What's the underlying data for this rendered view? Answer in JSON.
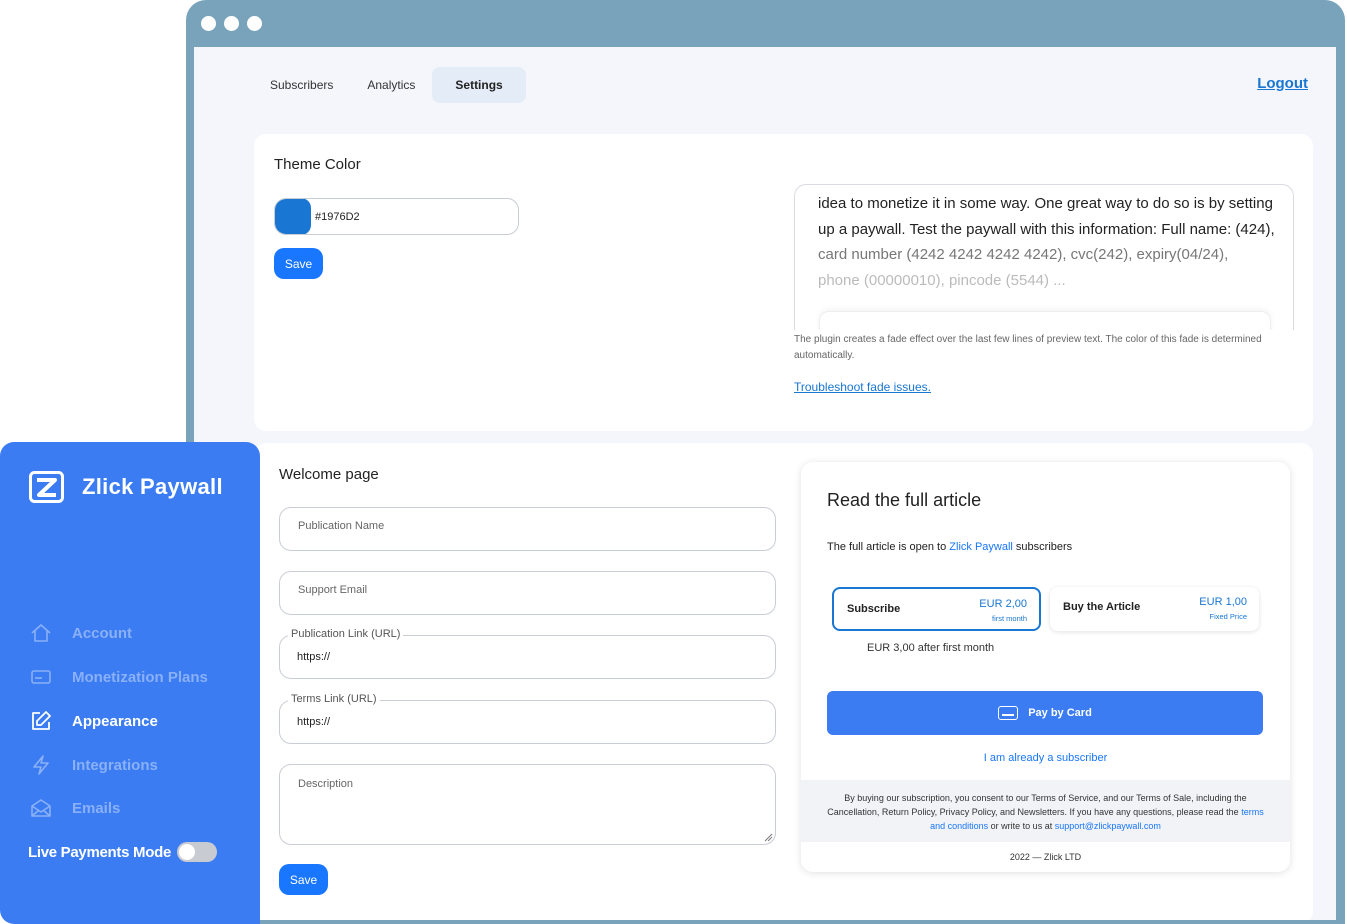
{
  "nav": {
    "tabs": [
      {
        "label": "Subscribers"
      },
      {
        "label": "Analytics"
      },
      {
        "label": "Settings"
      }
    ],
    "logout_label": "Logout"
  },
  "theme": {
    "title": "Theme Color",
    "color_value": "#1976D2",
    "save_label": "Save",
    "preview_lines": [
      "idea to monetize it in some way. One great way to do so is by setting",
      "up a paywall. Test the paywall with this information: Full name: (424),",
      "card number (4242 4242 4242 4242), cvc(242), expiry(04/24),",
      "phone (00000010), pincode (5544) ..."
    ],
    "fade_note": "The plugin creates a fade effect over the last few lines of preview text. The color of this fade is determined automatically.",
    "fade_link": "Troubleshoot fade issues."
  },
  "welcome": {
    "title": "Welcome page",
    "publication_name_placeholder": "Publication Name",
    "support_email_placeholder": "Support Email",
    "publication_link_label": "Publication Link (URL)",
    "publication_link_value": "https://",
    "terms_link_label": "Terms Link (URL)",
    "terms_link_value": "https://",
    "description_placeholder": "Description",
    "save_label": "Save"
  },
  "paywall": {
    "title": "Read the full article",
    "subtitle_prefix": "The full article is open to ",
    "subtitle_brand": "Zlick Paywall",
    "subtitle_suffix": " subscribers",
    "options": [
      {
        "name": "Subscribe",
        "price": "EUR 2,00",
        "note": "first month"
      },
      {
        "name": "Buy the Article",
        "price": "EUR 1,00",
        "note": "Fixed Price"
      }
    ],
    "after_text": "EUR 3,00 after first month",
    "pay_label": "Pay by Card",
    "already_label": "I am already a subscriber",
    "legal_text": "By buying our subscription, you consent to our Terms of Service, and our Terms of Sale, including the Cancellation, Return Policy, Privacy Policy, and Newsletters. If you have any questions, please read the ",
    "legal_link": "terms and conditions",
    "legal_mid": " or write to us at ",
    "legal_email": "support@zlickpaywall.com",
    "copyright": "2022 — Zlick LTD"
  },
  "sidebar": {
    "brand": "Zlick Paywall",
    "items": [
      {
        "label": "Account",
        "icon": "home-icon"
      },
      {
        "label": "Monetization Plans",
        "icon": "credit-card-icon"
      },
      {
        "label": "Appearance",
        "icon": "edit-icon"
      },
      {
        "label": "Integrations",
        "icon": "lightning-icon"
      },
      {
        "label": "Emails",
        "icon": "envelope-icon"
      }
    ],
    "live_mode_label": "Live Payments Mode"
  },
  "colors": {
    "accent": "#1976d2",
    "primary_button": "#1976ff",
    "sidebar_bg": "#3b7cf2",
    "frame": "#79a3ba"
  }
}
